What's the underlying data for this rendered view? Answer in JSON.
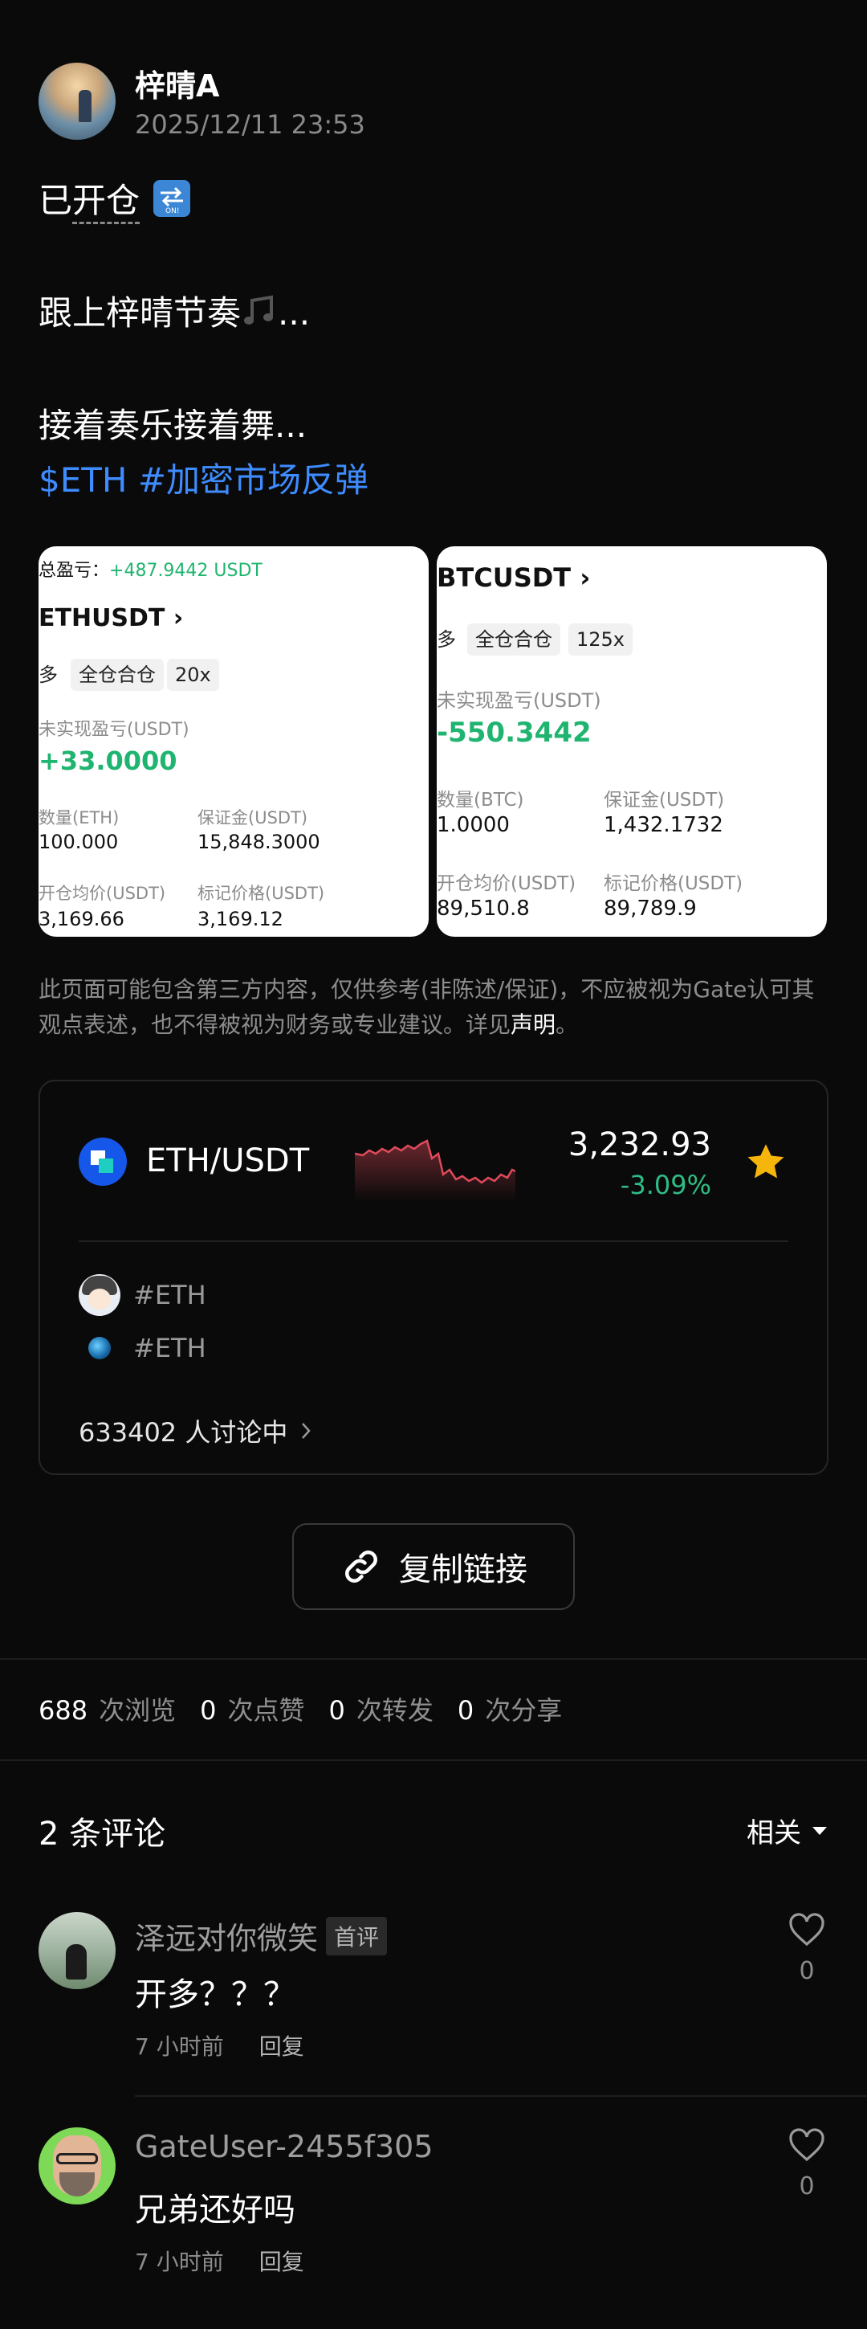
{
  "author": {
    "name": "梓晴A",
    "time": "2025/12/11 23:53"
  },
  "post": {
    "line1_prefix": "已",
    "line1_underlined": "开仓",
    "line2": "跟上梓晴节奏",
    "line2_suffix": "...",
    "line3": "接着奏乐接着舞...",
    "tags": "$ETH #加密市场反弹"
  },
  "screenshots": {
    "eth": {
      "total_pnl_label": "总盈亏：",
      "total_pnl_value": "+487.9442 USDT",
      "symbol": "ETHUSDT",
      "side": "多",
      "margin_mode": "全仓合仓",
      "leverage": "20x",
      "unrealized_label": "未实现盈亏(USDT)",
      "unrealized_value": "+33.0000",
      "qty_label": "数量(ETH)",
      "qty_value": "100.000",
      "margin_label": "保证金(USDT)",
      "margin_value": "15,848.3000",
      "entry_label": "开仓均价(USDT)",
      "entry_value": "3,169.66",
      "mark_label": "标记价格(USDT)",
      "mark_value": "3,169.12"
    },
    "btc": {
      "symbol": "BTCUSDT",
      "side": "多",
      "margin_mode": "全仓合仓",
      "leverage": "125x",
      "unrealized_label": "未实现盈亏(USDT)",
      "unrealized_value": "-550.3442",
      "qty_label": "数量(BTC)",
      "qty_value": "1.0000",
      "margin_label": "保证金(USDT)",
      "margin_value": "1,432.1732",
      "entry_label": "开仓均价(USDT)",
      "entry_value": "89,510.8",
      "mark_label": "标记价格(USDT)",
      "mark_value": "89,789.9"
    }
  },
  "disclaimer": {
    "text": "此页面可能包含第三方内容，仅供参考(非陈述/保证)，不应被视为Gate认可其观点表述，也不得被视为财务或专业建议。详见",
    "link": "声明",
    "end": "。"
  },
  "market": {
    "pair": "ETH/USDT",
    "price": "3,232.93",
    "change": "-3.09%",
    "topics": [
      "#ETH",
      "#ETH"
    ],
    "discussing": "633402 人讨论中"
  },
  "copy_link": "复制链接",
  "stats": [
    {
      "num": "688",
      "label": "次浏览"
    },
    {
      "num": "0",
      "label": "次点赞"
    },
    {
      "num": "0",
      "label": "次转发"
    },
    {
      "num": "0",
      "label": "次分享"
    }
  ],
  "comments_section": {
    "title": "2 条评论",
    "sort": "相关"
  },
  "comments": [
    {
      "user": "泽远对你微笑",
      "badge": "首评",
      "text": "开多？？？",
      "time": "7 小时前",
      "reply": "回复",
      "likes": "0"
    },
    {
      "user": "GateUser-2455f305",
      "text": "兄弟还好吗",
      "time": "7 小时前",
      "reply": "回复",
      "likes": "0"
    }
  ],
  "colors": {
    "background": "#0a0a0a",
    "link": "#3e8cff",
    "down": "#2ebd85",
    "star": "#f5b50a"
  }
}
